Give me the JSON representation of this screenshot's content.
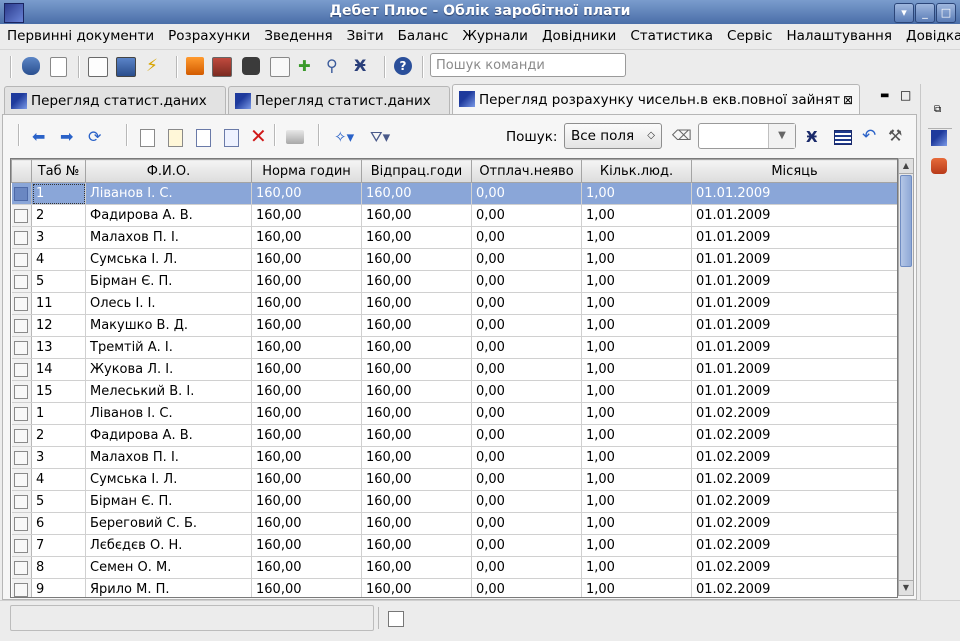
{
  "window": {
    "title": "Дебет Плюс - Облік заробітної плати",
    "buttons": [
      "▾",
      "_",
      "□",
      "×"
    ]
  },
  "menu": [
    "Первинні документи",
    "Розрахунки",
    "Зведення",
    "Звіти",
    "Баланс",
    "Журнали",
    "Довідники",
    "Статистика",
    "Сервіс",
    "Налаштування",
    "Довідка"
  ],
  "toolbar": {
    "command_search_placeholder": "Пошук команди",
    "icons": [
      "database-icon",
      "new-document-icon",
      "report-icon",
      "monitor-icon",
      "lightning-icon",
      "orange-box-icon",
      "portrait-icon",
      "camera-icon",
      "calendar-icon",
      "add-user-icon",
      "magnifier-icon",
      "binoculars-icon",
      "help-icon"
    ]
  },
  "tabs": [
    {
      "label": "Перегляд статист.даних",
      "active": false
    },
    {
      "label": "Перегляд статист.даних",
      "active": false
    },
    {
      "label": "Перегляд розрахунку чисельн.в екв.повної зайнят",
      "active": true,
      "close": "⊠"
    }
  ],
  "panel_controls": {
    "minimize": "▬",
    "restore": "□"
  },
  "grid_toolbar": {
    "search_label": "Пошук:",
    "search_field_value": "Все поля",
    "search_text": ""
  },
  "grid": {
    "columns": [
      "Таб №",
      "Ф.И.О.",
      "Норма годин",
      "Відпрац.годи",
      "Отплач.неяво",
      "Кільк.люд.",
      "Місяць"
    ],
    "rows": [
      [
        "1",
        "Ліванов І. С.",
        "160,00",
        "160,00",
        "0,00",
        "1,00",
        "01.01.2009"
      ],
      [
        "2",
        "Фадирова А. В.",
        "160,00",
        "160,00",
        "0,00",
        "1,00",
        "01.01.2009"
      ],
      [
        "3",
        "Малахов П. І.",
        "160,00",
        "160,00",
        "0,00",
        "1,00",
        "01.01.2009"
      ],
      [
        "4",
        "Сумська І. Л.",
        "160,00",
        "160,00",
        "0,00",
        "1,00",
        "01.01.2009"
      ],
      [
        "5",
        "Бірман Є. П.",
        "160,00",
        "160,00",
        "0,00",
        "1,00",
        "01.01.2009"
      ],
      [
        "11",
        "Олесь І. І.",
        "160,00",
        "160,00",
        "0,00",
        "1,00",
        "01.01.2009"
      ],
      [
        "12",
        "Макушко В. Д.",
        "160,00",
        "160,00",
        "0,00",
        "1,00",
        "01.01.2009"
      ],
      [
        "13",
        "Тремтій А. І.",
        "160,00",
        "160,00",
        "0,00",
        "1,00",
        "01.01.2009"
      ],
      [
        "14",
        "Жукова Л. І.",
        "160,00",
        "160,00",
        "0,00",
        "1,00",
        "01.01.2009"
      ],
      [
        "15",
        "Мелеський В. І.",
        "160,00",
        "160,00",
        "0,00",
        "1,00",
        "01.01.2009"
      ],
      [
        "1",
        "Ліванов І. С.",
        "160,00",
        "160,00",
        "0,00",
        "1,00",
        "01.02.2009"
      ],
      [
        "2",
        "Фадирова А. В.",
        "160,00",
        "160,00",
        "0,00",
        "1,00",
        "01.02.2009"
      ],
      [
        "3",
        "Малахов П. І.",
        "160,00",
        "160,00",
        "0,00",
        "1,00",
        "01.02.2009"
      ],
      [
        "4",
        "Сумська І. Л.",
        "160,00",
        "160,00",
        "0,00",
        "1,00",
        "01.02.2009"
      ],
      [
        "5",
        "Бірман Є. П.",
        "160,00",
        "160,00",
        "0,00",
        "1,00",
        "01.02.2009"
      ],
      [
        "6",
        "Береговий С. Б.",
        "160,00",
        "160,00",
        "0,00",
        "1,00",
        "01.02.2009"
      ],
      [
        "7",
        "Лєбєдєв О. Н.",
        "160,00",
        "160,00",
        "0,00",
        "1,00",
        "01.02.2009"
      ],
      [
        "8",
        "Семен О. М.",
        "160,00",
        "160,00",
        "0,00",
        "1,00",
        "01.02.2009"
      ],
      [
        "9",
        "Ярило М. П.",
        "160,00",
        "160,00",
        "0,00",
        "1,00",
        "01.02.2009"
      ]
    ],
    "selected_row_index": 0
  },
  "colors": {
    "selection": "#8aa6d8",
    "titlebar": "#4a6ea8"
  }
}
